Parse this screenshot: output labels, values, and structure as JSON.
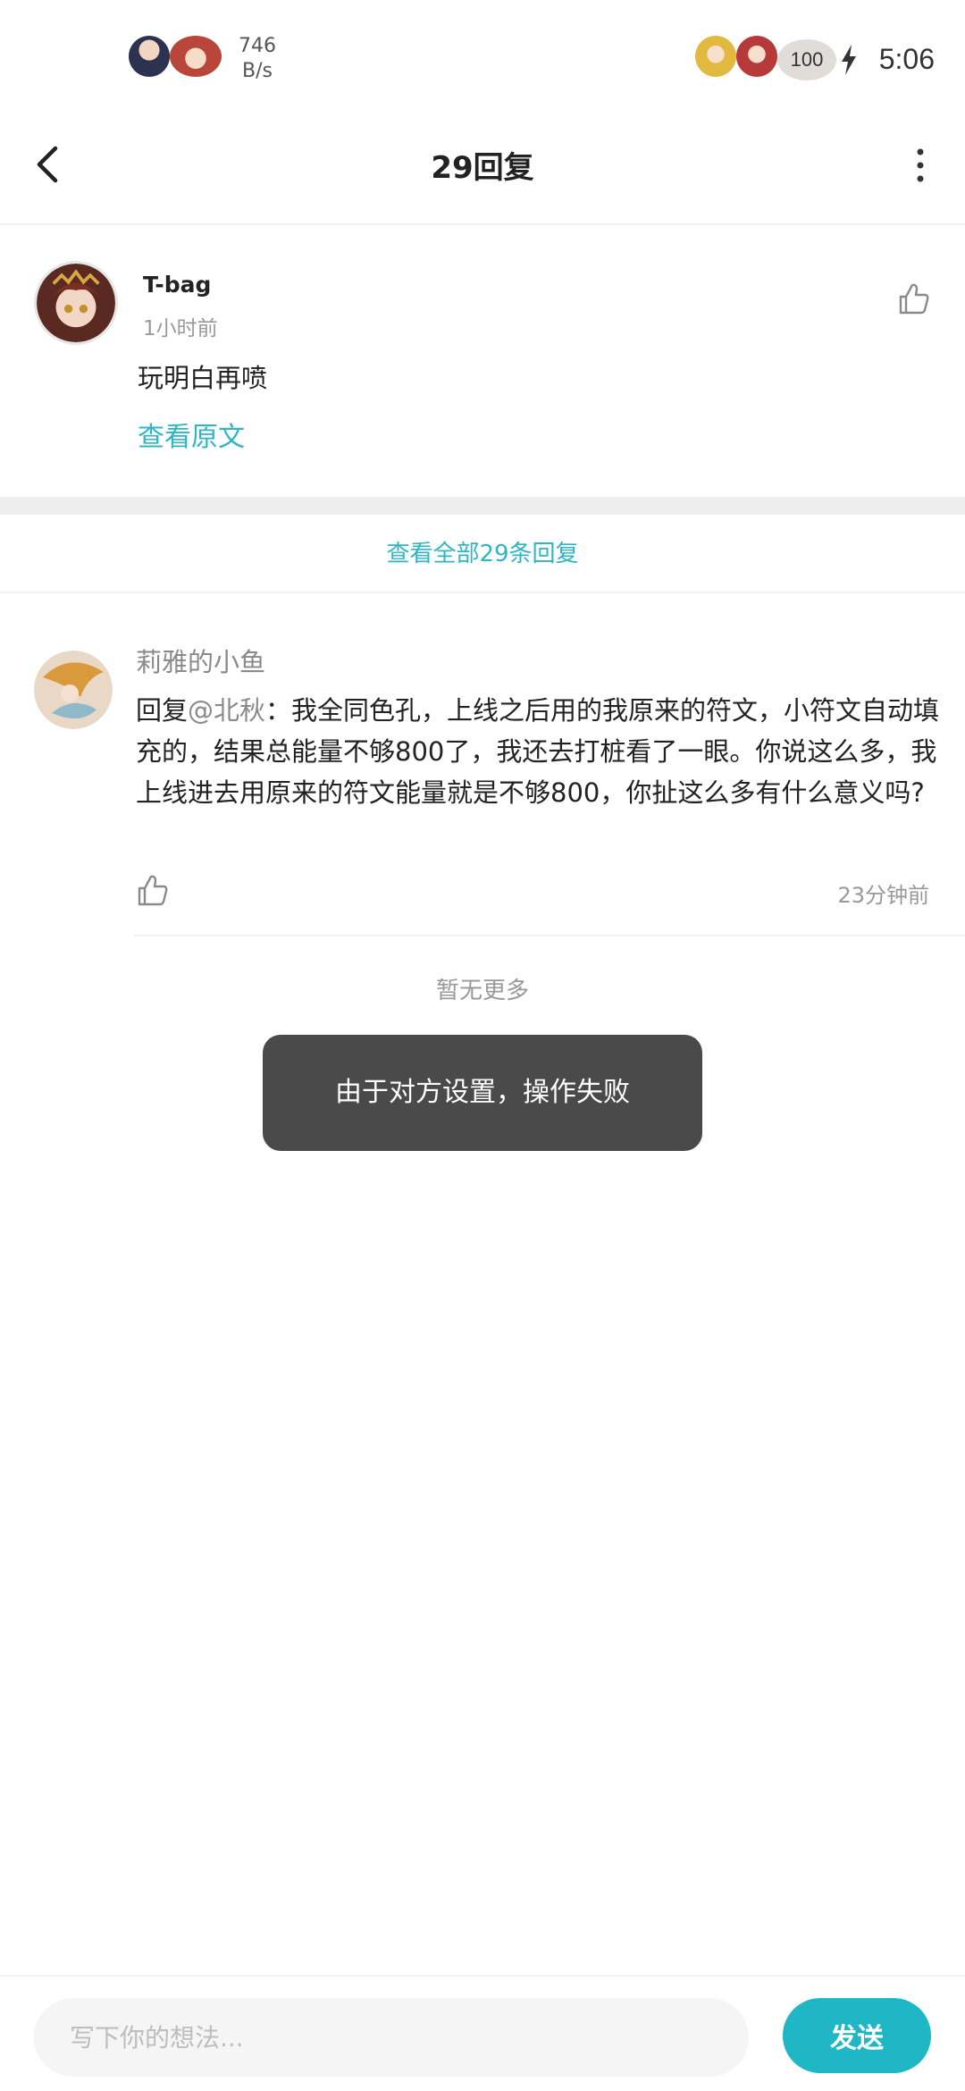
{
  "status_bar": {
    "net_speed_value": "746",
    "net_speed_unit": "B/s",
    "battery": "100",
    "time": "5:06"
  },
  "header": {
    "title": "29回复"
  },
  "original_comment": {
    "username": "T-bag",
    "time": "1小时前",
    "text": "玩明白再喷",
    "view_original_label": "查看原文"
  },
  "view_all_label": "查看全部29条回复",
  "reply": {
    "username": "莉雅的小鱼",
    "prefix": "回复",
    "mention": "@北秋",
    "text": "：我全同色孔，上线之后用的我原来的符文，小符文自动填充的，结果总能量不够800了，我还去打桩看了一眼。你说这么多，我上线进去用原来的符文能量就是不够800，你扯这么多有什么意义吗?",
    "time": "23分钟前"
  },
  "no_more_label": "暂无更多",
  "toast": "由于对方设置，操作失败",
  "input": {
    "placeholder": "写下你的想法..."
  },
  "send_label": "发送",
  "colors": {
    "accent": "#1fb7c5",
    "link": "#2fb6c2",
    "toast_bg": "#4a4a4a"
  }
}
